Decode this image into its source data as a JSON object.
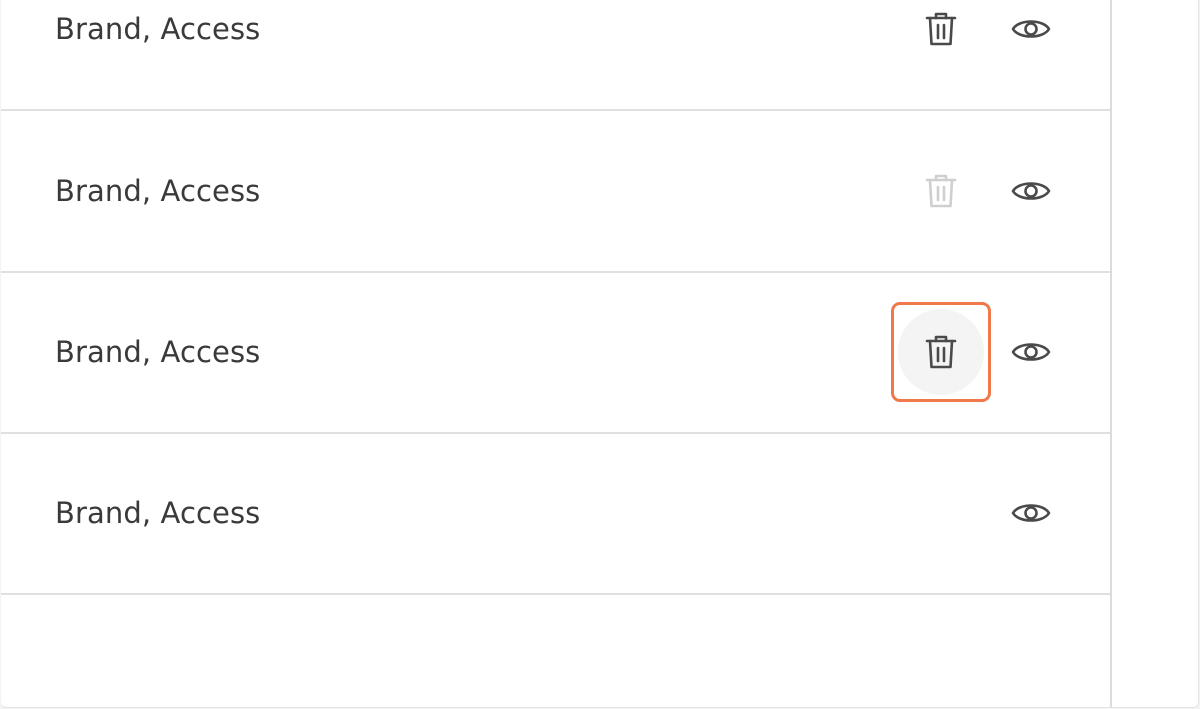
{
  "rows": [
    {
      "label": "Brand, Access",
      "trash": "enabled",
      "eye": true
    },
    {
      "label": "Brand, Access",
      "trash": "disabled",
      "eye": true
    },
    {
      "label": "Brand, Access",
      "trash": "focused",
      "eye": true
    },
    {
      "label": "Brand, Access",
      "trash": "none",
      "eye": true
    }
  ],
  "colors": {
    "icon": "#4a4a4a",
    "icon_disabled": "#cfcfcf",
    "focus_ring": "#f0784a",
    "text": "#3a3a3a",
    "divider": "#e0e0e0"
  }
}
